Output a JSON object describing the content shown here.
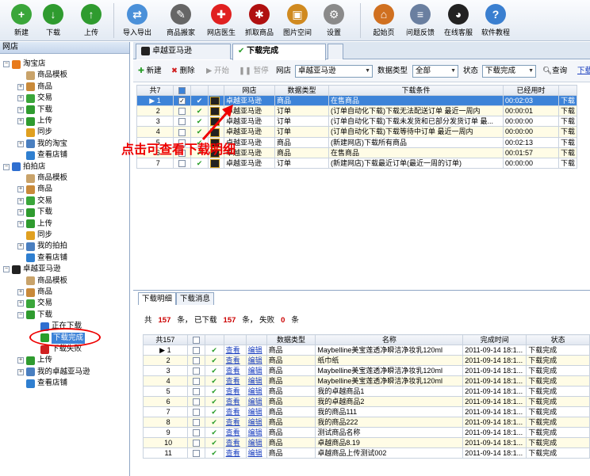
{
  "toolbar": [
    {
      "label": "新建",
      "icon": "new-doc-icon",
      "color": "#3aa63a",
      "glyph": "+"
    },
    {
      "label": "下载",
      "icon": "download-icon",
      "color": "#2f9b2f",
      "glyph": "↓"
    },
    {
      "label": "上传",
      "icon": "upload-icon",
      "color": "#2f9b2f",
      "glyph": "↑"
    },
    {
      "label": "导入导出",
      "icon": "import-export-icon",
      "color": "#4a90d9",
      "glyph": "⇄"
    },
    {
      "label": "商品搬家",
      "icon": "move-goods-icon",
      "color": "#666666",
      "glyph": "✎"
    },
    {
      "label": "网店医生",
      "icon": "doctor-cross-icon",
      "color": "#e02020",
      "glyph": "✚"
    },
    {
      "label": "抓取商品",
      "icon": "spider-icon",
      "color": "#b01010",
      "glyph": "✱"
    },
    {
      "label": "图片空间",
      "icon": "picture-icon",
      "color": "#d08a20",
      "glyph": "▣"
    },
    {
      "label": "设置",
      "icon": "gear-icon",
      "color": "#8a8a8a",
      "glyph": "⚙"
    },
    {
      "label": "起始页",
      "icon": "home-icon",
      "color": "#d07020",
      "glyph": "⌂"
    },
    {
      "label": "问题反馈",
      "icon": "clipboard-icon",
      "color": "#6a7fa0",
      "glyph": "≡"
    },
    {
      "label": "在线客服",
      "icon": "qq-penguin-icon",
      "color": "#222222",
      "glyph": "◕"
    },
    {
      "label": "软件教程",
      "icon": "help-icon",
      "color": "#3a7fd0",
      "glyph": "?"
    }
  ],
  "left_panel": {
    "title": "网店"
  },
  "tree": [
    {
      "label": "淘宝店",
      "level": 0,
      "pm": "−",
      "icon": "taobao-store-icon",
      "color": "#e87a1a"
    },
    {
      "label": "商品模板",
      "level": 1,
      "icon": "template-icon",
      "color": "#c9a36a"
    },
    {
      "label": "商品",
      "level": 1,
      "pm": "+",
      "icon": "goods-icon",
      "color": "#c98a3a"
    },
    {
      "label": "交易",
      "level": 1,
      "pm": "+",
      "icon": "trade-icon",
      "color": "#3aa63a"
    },
    {
      "label": "下载",
      "level": 1,
      "pm": "+",
      "icon": "download-icon",
      "color": "#2f9b2f"
    },
    {
      "label": "上传",
      "level": 1,
      "pm": "+",
      "icon": "upload-icon",
      "color": "#2f9b2f"
    },
    {
      "label": "同步",
      "level": 1,
      "icon": "sync-icon",
      "color": "#e0a020"
    },
    {
      "label": "我的淘宝",
      "level": 1,
      "pm": "+",
      "icon": "my-store-icon",
      "color": "#4a7fc0"
    },
    {
      "label": "查看店铺",
      "level": 1,
      "icon": "view-store-icon",
      "color": "#2f7fd0"
    },
    {
      "label": "拍拍店",
      "level": 0,
      "pm": "−",
      "icon": "paipai-store-icon",
      "color": "#2f6fd0"
    },
    {
      "label": "商品模板",
      "level": 1,
      "icon": "template-icon",
      "color": "#c9a36a"
    },
    {
      "label": "商品",
      "level": 1,
      "pm": "+",
      "icon": "goods-icon",
      "color": "#c98a3a"
    },
    {
      "label": "交易",
      "level": 1,
      "pm": "+",
      "icon": "trade-icon",
      "color": "#3aa63a"
    },
    {
      "label": "下载",
      "level": 1,
      "pm": "+",
      "icon": "download-icon",
      "color": "#2f9b2f"
    },
    {
      "label": "上传",
      "level": 1,
      "pm": "+",
      "icon": "upload-icon",
      "color": "#2f9b2f"
    },
    {
      "label": "同步",
      "level": 1,
      "icon": "sync-icon",
      "color": "#e0a020"
    },
    {
      "label": "我的拍拍",
      "level": 1,
      "pm": "+",
      "icon": "my-store-icon",
      "color": "#4a7fc0"
    },
    {
      "label": "查看店铺",
      "level": 1,
      "icon": "view-store-icon",
      "color": "#2f7fd0"
    },
    {
      "label": "卓越亚马逊",
      "level": 0,
      "pm": "−",
      "icon": "amazon-store-icon",
      "color": "#222222"
    },
    {
      "label": "商品模板",
      "level": 1,
      "icon": "template-icon",
      "color": "#c9a36a"
    },
    {
      "label": "商品",
      "level": 1,
      "pm": "+",
      "icon": "goods-icon",
      "color": "#c98a3a"
    },
    {
      "label": "交易",
      "level": 1,
      "pm": "+",
      "icon": "trade-icon",
      "color": "#3aa63a"
    },
    {
      "label": "下载",
      "level": 1,
      "pm": "−",
      "icon": "download-icon",
      "color": "#2f9b2f"
    },
    {
      "label": "正在下载",
      "level": 2,
      "icon": "downloading-icon",
      "color": "#2f6fd0"
    },
    {
      "label": "下载完成",
      "level": 2,
      "icon": "check-icon",
      "color": "#2a9e2a",
      "selected": true
    },
    {
      "label": "下载失败",
      "level": 2,
      "icon": "fail-icon",
      "color": "#d02020"
    },
    {
      "label": "上传",
      "level": 1,
      "pm": "+",
      "icon": "upload-icon",
      "color": "#2f9b2f"
    },
    {
      "label": "我的卓越亚马逊",
      "level": 1,
      "pm": "+",
      "icon": "my-store-icon",
      "color": "#4a7fc0"
    },
    {
      "label": "查看店铺",
      "level": 1,
      "icon": "view-store-icon",
      "color": "#2f7fd0"
    }
  ],
  "tabs": [
    {
      "label": "卓越亚马逊"
    },
    {
      "label": "下载完成"
    }
  ],
  "subbar": {
    "new": "新建",
    "delete": "删除",
    "start": "开始",
    "pause": "暂停",
    "store_label": "网店",
    "store_value": "卓越亚马逊",
    "type_label": "数据类型",
    "type_value": "全部",
    "status_label": "状态",
    "status_value": "下载完成",
    "query": "查询",
    "download": "下载"
  },
  "top_table": {
    "headers": [
      "共7",
      "",
      "",
      "",
      "网店",
      "数据类型",
      "下载条件",
      "已经用时",
      "ﾠ"
    ],
    "rows": [
      {
        "no": "1",
        "store": "卓越亚马逊",
        "type": "商品",
        "cond": "在售商品",
        "time": "00:02:03",
        "status": "下载"
      },
      {
        "no": "2",
        "store": "卓越亚马逊",
        "type": "订单",
        "cond": "(订单自动化下载)下载无法配送订单 最近一周内",
        "time": "00:00:01",
        "status": "下载"
      },
      {
        "no": "3",
        "store": "卓越亚马逊",
        "type": "订单",
        "cond": "(订单自动化下载)下载未发货和已部分发货订单 最...",
        "time": "00:00:00",
        "status": "下载"
      },
      {
        "no": "4",
        "store": "卓越亚马逊",
        "type": "订单",
        "cond": "(订单自动化下载)下载等待中订单 最近一周内",
        "time": "00:00:00",
        "status": "下载"
      },
      {
        "no": "5",
        "store": "卓越亚马逊",
        "type": "商品",
        "cond": "(新建网店)下载所有商品",
        "time": "00:02:13",
        "status": "下载"
      },
      {
        "no": "6",
        "store": "卓越亚马逊",
        "type": "商品",
        "cond": "在售商品",
        "time": "00:01:57",
        "status": "下载"
      },
      {
        "no": "7",
        "store": "卓越亚马逊",
        "type": "订单",
        "cond": "(新建网店)下载最近订单(最近一周的订单)",
        "time": "00:00:00",
        "status": "下载"
      }
    ]
  },
  "annotation": "点击可查看下载明细",
  "bottom_tabs": [
    {
      "label": "下载明细"
    },
    {
      "label": "下载消息"
    }
  ],
  "summary": {
    "p1": "共",
    "total": "157",
    "p2": "条，",
    "p3": "已下载",
    "done": "157",
    "p4": "条，",
    "p5": "失败",
    "fail": "0",
    "p6": "条"
  },
  "bottom_table": {
    "headers": [
      "共157",
      "",
      "",
      "",
      "",
      "数据类型",
      "名称",
      "完成时间",
      "状态"
    ],
    "view": "查看",
    "edit": "编辑",
    "rows": [
      {
        "no": "1",
        "type": "商品",
        "name": "Maybelline美宝莲透净瞬洁净妆乳120ml",
        "time": "2011-09-14 18:1...",
        "status": "下载完成"
      },
      {
        "no": "2",
        "type": "商品",
        "name": "纸巾纸",
        "time": "2011-09-14 18:1...",
        "status": "下载完成"
      },
      {
        "no": "3",
        "type": "商品",
        "name": "Maybelline美宝莲透净瞬洁净妆乳120ml",
        "time": "2011-09-14 18:1...",
        "status": "下载完成"
      },
      {
        "no": "4",
        "type": "商品",
        "name": "Maybelline美宝莲透净瞬洁净妆乳120ml",
        "time": "2011-09-14 18:1...",
        "status": "下载完成"
      },
      {
        "no": "5",
        "type": "商品",
        "name": "我的卓越商品1",
        "time": "2011-09-14 18:1...",
        "status": "下载完成"
      },
      {
        "no": "6",
        "type": "商品",
        "name": "我的卓越商品2",
        "time": "2011-09-14 18:1...",
        "status": "下载完成"
      },
      {
        "no": "7",
        "type": "商品",
        "name": "我的商品111",
        "time": "2011-09-14 18:1...",
        "status": "下载完成"
      },
      {
        "no": "8",
        "type": "商品",
        "name": "我的商品222",
        "time": "2011-09-14 18:1...",
        "status": "下载完成"
      },
      {
        "no": "9",
        "type": "商品",
        "name": "测试商品名称",
        "time": "2011-09-14 18:1...",
        "status": "下载完成"
      },
      {
        "no": "10",
        "type": "商品",
        "name": "卓越商品8.19",
        "time": "2011-09-14 18:1...",
        "status": "下载完成"
      },
      {
        "no": "11",
        "type": "商品",
        "name": "卓越商品上传测试002",
        "time": "2011-09-14 18:1...",
        "status": "下载完成"
      }
    ]
  }
}
